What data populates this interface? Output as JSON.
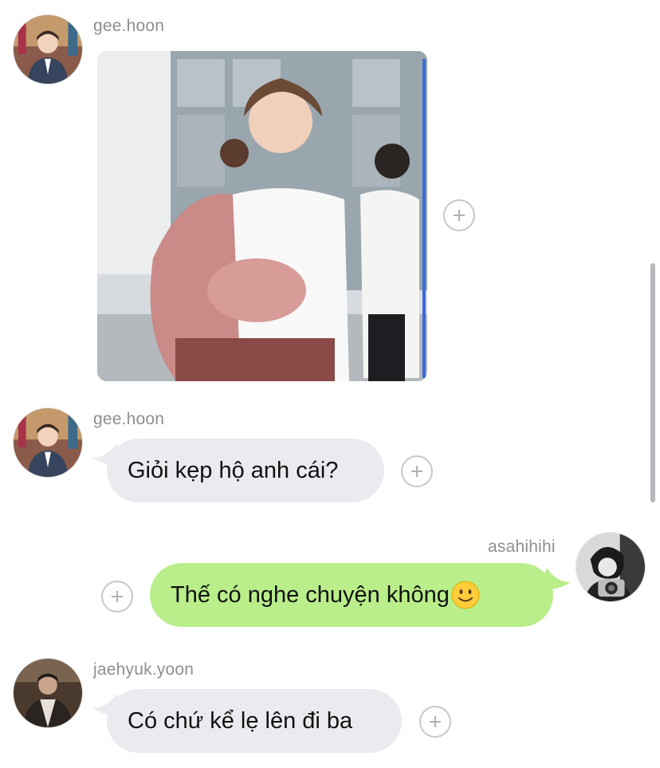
{
  "messages": [
    {
      "sender": "gee.hoon",
      "type": "image",
      "image_desc": "photo"
    },
    {
      "sender": "gee.hoon",
      "type": "text",
      "text": "Giỏi kẹp hộ anh cái?"
    },
    {
      "sender": "asahihihi",
      "type": "text",
      "text": "Thế có nghe chuyện không",
      "emoji": "slightly-smiling-face"
    },
    {
      "sender": "jaehyuk.yoon",
      "type": "text",
      "text": "Có chứ kể lẹ lên đi ba"
    }
  ],
  "colors": {
    "incoming_bubble": "#e9ebef",
    "outgoing_bubble": "#b9ee8a",
    "sender_name": "#8e8e93"
  }
}
